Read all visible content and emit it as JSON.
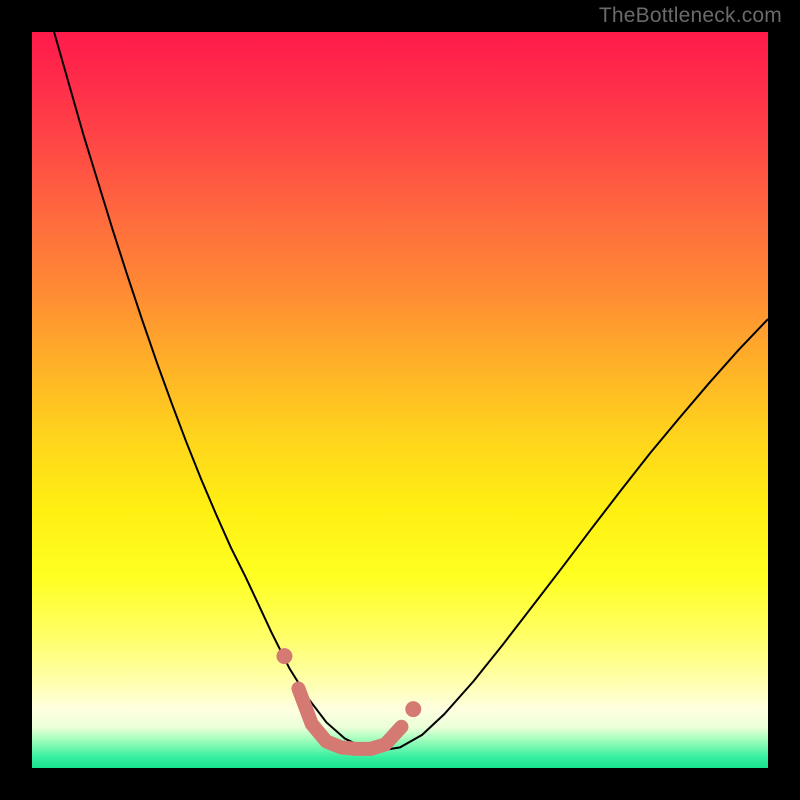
{
  "watermark": "TheBottleneck.com",
  "chart_data": {
    "type": "line",
    "title": "",
    "xlabel": "",
    "ylabel": "",
    "xlim": [
      0,
      100
    ],
    "ylim": [
      0,
      100
    ],
    "grid": false,
    "legend": false,
    "background": {
      "mode": "vertical-gradient",
      "stops": [
        {
          "offset": 0.0,
          "color": "#ff1a4c"
        },
        {
          "offset": 0.06,
          "color": "#ff2a4a"
        },
        {
          "offset": 0.15,
          "color": "#ff4646"
        },
        {
          "offset": 0.25,
          "color": "#ff6a3e"
        },
        {
          "offset": 0.35,
          "color": "#ff8a34"
        },
        {
          "offset": 0.45,
          "color": "#ffb028"
        },
        {
          "offset": 0.55,
          "color": "#ffd41c"
        },
        {
          "offset": 0.65,
          "color": "#fff012"
        },
        {
          "offset": 0.74,
          "color": "#ffff22"
        },
        {
          "offset": 0.82,
          "color": "#ffff66"
        },
        {
          "offset": 0.88,
          "color": "#ffffaa"
        },
        {
          "offset": 0.92,
          "color": "#ffffe0"
        },
        {
          "offset": 0.945,
          "color": "#eaffd8"
        },
        {
          "offset": 0.96,
          "color": "#a8ffbe"
        },
        {
          "offset": 0.985,
          "color": "#38efa0"
        },
        {
          "offset": 1.0,
          "color": "#16e290"
        }
      ]
    },
    "series": [
      {
        "name": "bottleneck-curve",
        "stroke": "#000000",
        "stroke_width": 2.0,
        "x": [
          3,
          5,
          7,
          9,
          11,
          13,
          15,
          17,
          19,
          21,
          23,
          25,
          27,
          29,
          30.5,
          32.5,
          35,
          37.5,
          40,
          42.5,
          45,
          47.5,
          50,
          53,
          56,
          60,
          64,
          68,
          72,
          76,
          80,
          84,
          88,
          92,
          96,
          100
        ],
        "y": [
          100,
          93,
          86,
          79.5,
          73,
          66.8,
          60.8,
          55,
          49.5,
          44.2,
          39.2,
          34.5,
          30,
          26,
          22.8,
          18.5,
          13.5,
          9.5,
          6.2,
          4.0,
          2.8,
          2.4,
          2.8,
          4.5,
          7.3,
          11.8,
          16.8,
          22.0,
          27.2,
          32.5,
          37.7,
          42.8,
          47.6,
          52.3,
          56.8,
          61.0
        ]
      },
      {
        "name": "flat-bottom-marker",
        "stroke": "#d57a73",
        "stroke_width": 14,
        "linecap": "round",
        "x": [
          36.2,
          38.0,
          40.0,
          42.0,
          44.0,
          46.0,
          48.0,
          50.2
        ],
        "y": [
          10.8,
          6.0,
          3.6,
          2.8,
          2.6,
          2.6,
          3.2,
          5.6
        ]
      }
    ],
    "markers": [
      {
        "name": "left-dot",
        "shape": "circle",
        "x": 34.3,
        "y": 15.2,
        "r": 8,
        "fill": "#d57a73"
      },
      {
        "name": "right-dot",
        "shape": "circle",
        "x": 51.8,
        "y": 8.0,
        "r": 8,
        "fill": "#d57a73"
      }
    ]
  }
}
